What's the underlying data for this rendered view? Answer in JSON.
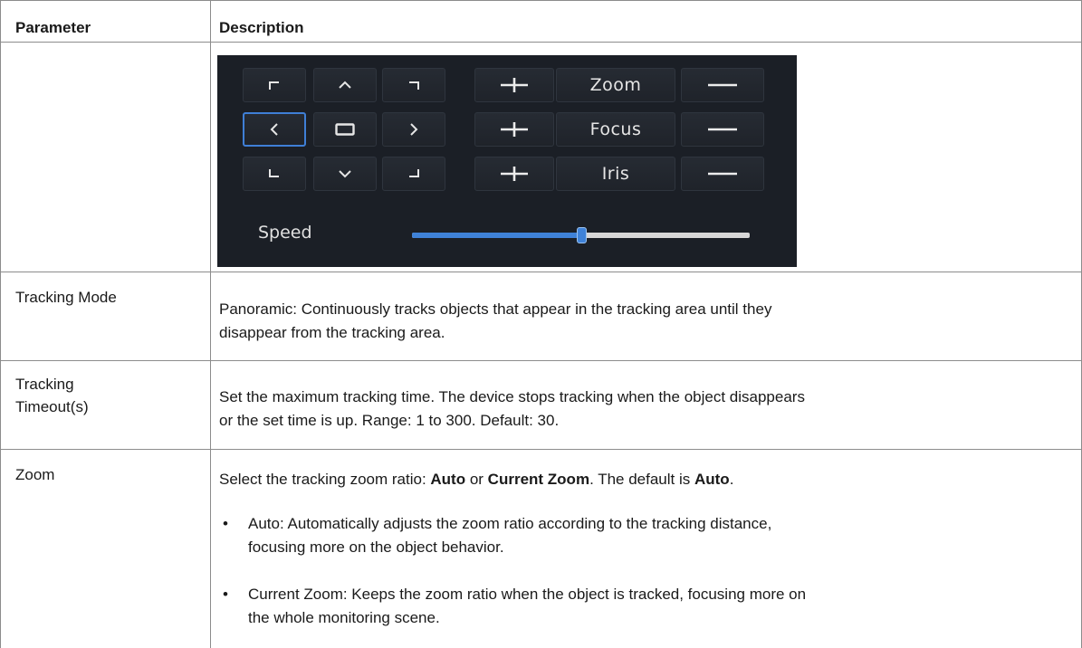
{
  "table": {
    "headers": {
      "parameter": "Parameter",
      "description": "Description"
    },
    "ptz_panel": {
      "zoom_label": "Zoom",
      "focus_label": "Focus",
      "iris_label": "Iris",
      "speed_label": "Speed",
      "speed_level": 0.5,
      "accent_color": "#3f82d8",
      "icons": [
        "up-left-icon",
        "up-icon",
        "up-right-icon",
        "left-icon",
        "center-icon",
        "right-icon",
        "down-left-icon",
        "down-icon",
        "down-right-icon",
        "plus-icon",
        "minus-icon"
      ]
    },
    "rows": {
      "tracking_mode": {
        "name": "Tracking Mode",
        "desc_line1": "Panoramic: Continuously tracks objects that appear in the tracking area until they",
        "desc_line2": "disappear from the tracking area."
      },
      "tracking_timeout": {
        "name_line1": "Tracking",
        "name_line2": "Timeout(s)",
        "desc_line1": "Set the maximum tracking time. The device stops tracking when the object disappears",
        "desc_line2": "or the set time is up. Range: 1 to 300. Default: 30."
      },
      "zoom": {
        "name": "Zoom",
        "intro_prefix": "Select the tracking zoom ratio: ",
        "intro_auto": "Auto",
        "intro_or": " or ",
        "intro_current": "Current Zoom",
        "intro_mid": ". The default is ",
        "intro_default": "Auto",
        "intro_end": ".",
        "bullet_symbol": "•",
        "bullet1_line1": "Auto: Automatically adjusts the zoom ratio according to the tracking distance,",
        "bullet1_line2": "focusing more on the object behavior.",
        "bullet2_line1": "Current Zoom: Keeps the zoom ratio when the object is tracked, focusing more on",
        "bullet2_line2": "the whole monitoring scene."
      }
    }
  }
}
